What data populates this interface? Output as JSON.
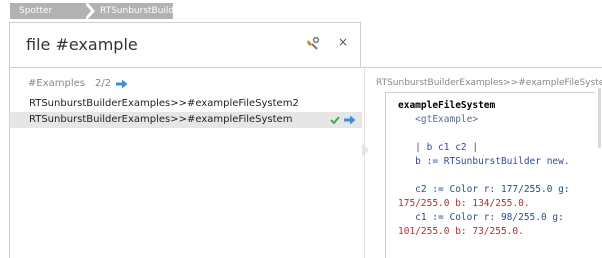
{
  "breadcrumb": {
    "items": [
      "Spotter",
      "RTSunburstBuilder"
    ]
  },
  "header": {
    "search_text": "file #example",
    "tool_icon": "wrench-icon",
    "close_label": "×"
  },
  "list": {
    "group": {
      "name": "#Examples",
      "count": "2/2"
    },
    "items": [
      {
        "label": "RTSunburstBuilderExamples>>#exampleFileSystem2",
        "selected": false
      },
      {
        "label": "RTSunburstBuilderExamples>>#exampleFileSystem",
        "selected": true
      }
    ]
  },
  "preview": {
    "title": "RTSunburstBuilderExamples>>#exampleFileSysten",
    "code_lines": [
      "exampleFileSystem",
      "   <gtExample>",
      "",
      "   | b c1 c2 |",
      "   b := RTSunburstBuilder new.",
      "",
      "   c2 := Color r: 177/255.0 g:",
      "175/255.0 b: 134/255.0.",
      "   c1 := Color r: 98/255.0 g:",
      "101/255.0 b: 73/255.0."
    ]
  },
  "colors": {
    "accent": "#3a8fd6",
    "check": "#4aa84a",
    "breadcrumb_bg": "#b2b2b2",
    "selection_bg": "#e6e6e6"
  }
}
